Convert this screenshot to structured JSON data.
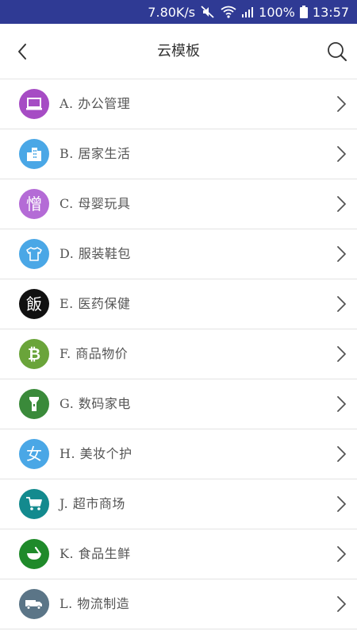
{
  "status": {
    "speed": "7.80K/s",
    "battery": "100%",
    "time": "13:57"
  },
  "header": {
    "title": "云模板"
  },
  "categories": [
    {
      "label": "A. 办公管理",
      "icon": "laptop-icon",
      "color": "#a64cc4"
    },
    {
      "label": "B. 居家生活",
      "icon": "buildings-icon",
      "color": "#4aa7e6"
    },
    {
      "label": "C. 母婴玩具",
      "icon": "cjk-glyph-icon",
      "glyph": "憎",
      "color": "#b46bd6"
    },
    {
      "label": "D. 服装鞋包",
      "icon": "tshirt-icon",
      "color": "#4aa7e6"
    },
    {
      "label": "E. 医药保健",
      "icon": "cjk-glyph-icon",
      "glyph": "飯",
      "color": "#111111"
    },
    {
      "label": "F. 商品物价",
      "icon": "bitcoin-icon",
      "color": "#6aa43a"
    },
    {
      "label": "G. 数码家电",
      "icon": "flashlight-icon",
      "color": "#3a8a3a"
    },
    {
      "label": "H. 美妆个护",
      "icon": "cjk-glyph-icon",
      "glyph": "女",
      "color": "#4aa7e6"
    },
    {
      "label": "J. 超市商场",
      "icon": "cart-icon",
      "color": "#138a8e"
    },
    {
      "label": "K. 食品生鲜",
      "icon": "mortar-bowl-icon",
      "color": "#1f8a2a"
    },
    {
      "label": "L. 物流制造",
      "icon": "truck-icon",
      "color": "#5b7587"
    }
  ]
}
